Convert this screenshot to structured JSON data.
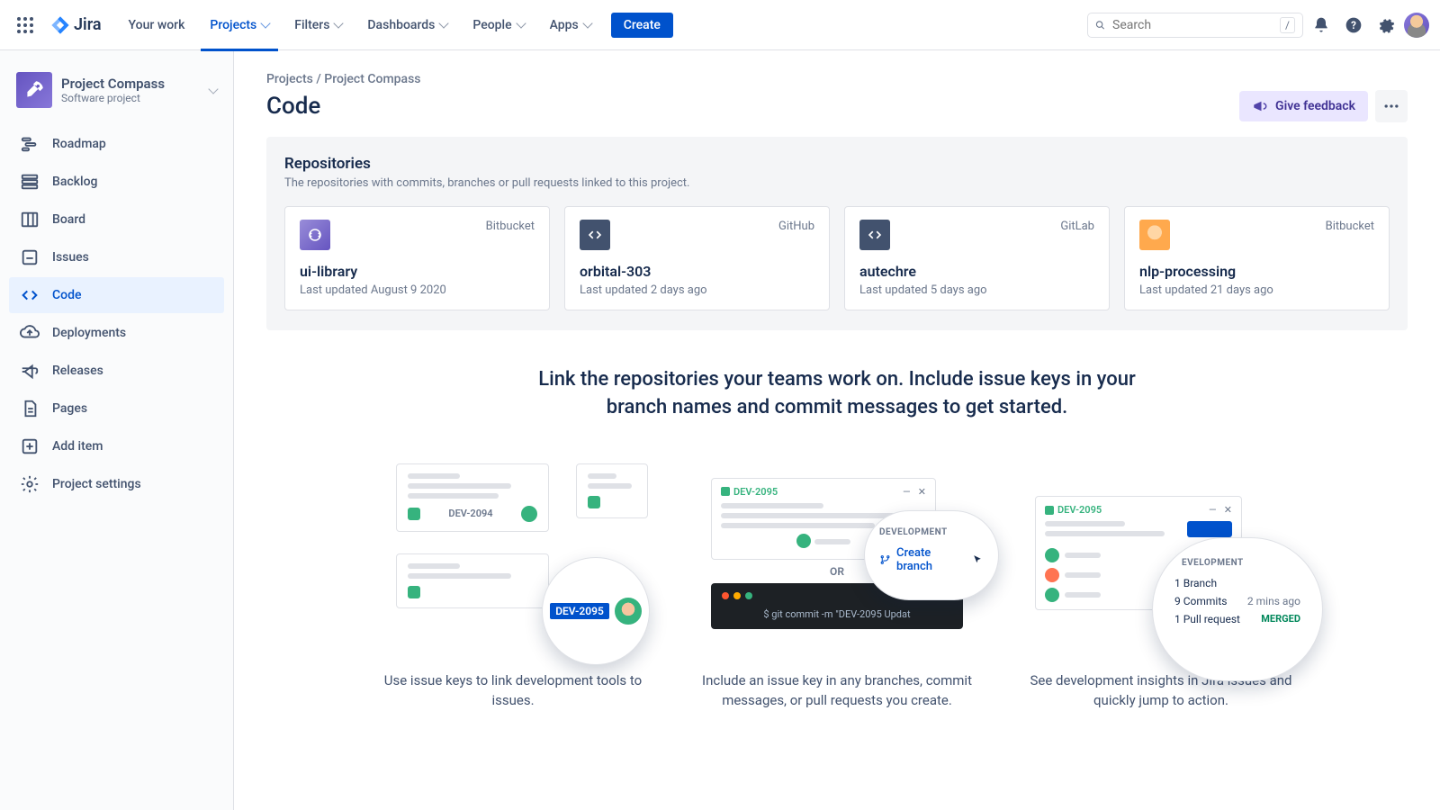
{
  "topnav": {
    "logo_text": "Jira",
    "links": [
      {
        "label": "Your work",
        "active": false
      },
      {
        "label": "Projects",
        "active": true
      },
      {
        "label": "Filters",
        "active": false
      },
      {
        "label": "Dashboards",
        "active": false
      },
      {
        "label": "People",
        "active": false
      },
      {
        "label": "Apps",
        "active": false
      }
    ],
    "create_label": "Create",
    "search_placeholder": "Search",
    "search_key": "/"
  },
  "project": {
    "name": "Project Compass",
    "subtitle": "Software project"
  },
  "sidebar": [
    {
      "label": "Roadmap",
      "icon": "roadmap",
      "active": false
    },
    {
      "label": "Backlog",
      "icon": "backlog",
      "active": false
    },
    {
      "label": "Board",
      "icon": "board",
      "active": false
    },
    {
      "label": "Issues",
      "icon": "issues",
      "active": false
    },
    {
      "label": "Code",
      "icon": "code",
      "active": true
    },
    {
      "label": "Deployments",
      "icon": "deploy",
      "active": false
    },
    {
      "label": "Releases",
      "icon": "releases",
      "active": false
    },
    {
      "label": "Pages",
      "icon": "pages",
      "active": false
    },
    {
      "label": "Add item",
      "icon": "add",
      "active": false
    },
    {
      "label": "Project settings",
      "icon": "settings",
      "active": false
    }
  ],
  "breadcrumbs": {
    "a": "Projects",
    "b": "Project Compass",
    "sep": " / "
  },
  "page": {
    "title": "Code",
    "feedback_label": "Give feedback"
  },
  "repos": {
    "title": "Repositories",
    "desc": "The repositories with commits, branches or pull requests linked to this project.",
    "items": [
      {
        "name": "ui-library",
        "source": "Bitbucket",
        "updated": "Last updated August 9 2020",
        "icon": "purple"
      },
      {
        "name": "orbital-303",
        "source": "GitHub",
        "updated": "Last updated 2 days ago",
        "icon": "dark"
      },
      {
        "name": "autechre",
        "source": "GitLab",
        "updated": "Last updated 5 days ago",
        "icon": "dark"
      },
      {
        "name": "nlp-processing",
        "source": "Bitbucket",
        "updated": "Last updated 21 days ago",
        "icon": "img"
      }
    ]
  },
  "hero": {
    "text": "Link the repositories your teams work on. Include issue keys in your branch names and commit messages to get started.",
    "cols": [
      {
        "caption": "Use issue keys to link development tools to issues."
      },
      {
        "caption": "Include an issue key in any branches, commit messages, or pull requests you create."
      },
      {
        "caption": "See development insights in Jira issues and quickly jump to action."
      }
    ]
  },
  "ill1": {
    "key1": "DEV-2094",
    "key2": "DEV-2095"
  },
  "ill2": {
    "issue": "DEV-2095",
    "dev_header": "DEVELOPMENT",
    "create_branch": "Create branch",
    "or": "OR",
    "cmd": "$ git commit -m \"DEV-2095 Updat"
  },
  "ill3": {
    "issue": "DEV-2095",
    "dev_header": "EVELOPMENT",
    "rows": [
      {
        "a": "1 Branch",
        "b": ""
      },
      {
        "a": "9 Commits",
        "b": "2 mins ago"
      },
      {
        "a": "1 Pull request",
        "b": "MERGED"
      }
    ]
  }
}
